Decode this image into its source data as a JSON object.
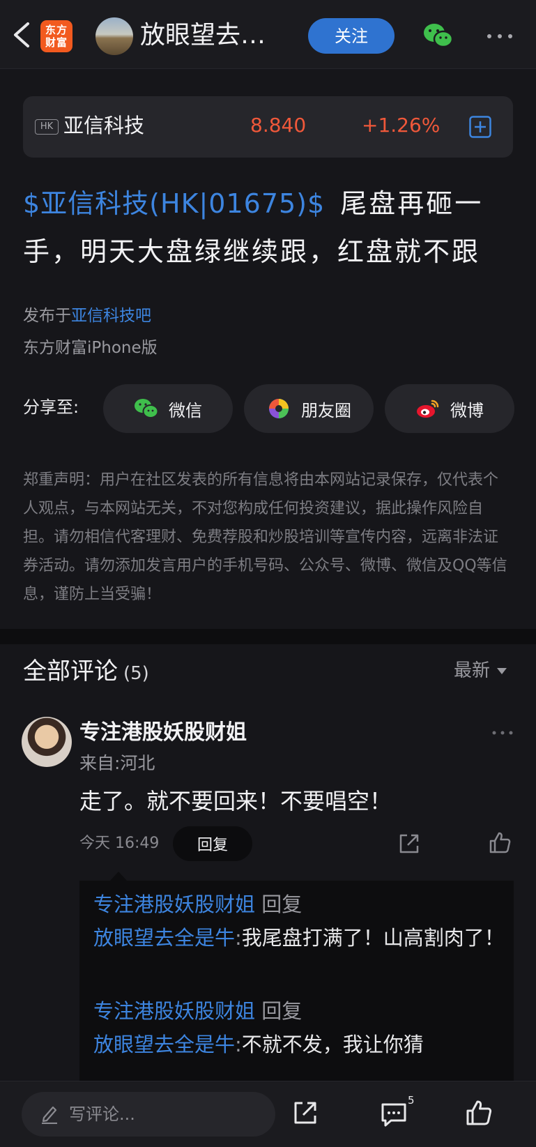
{
  "header": {
    "logo_text": "东方财富",
    "title": "放眼望去全是牛",
    "follow_label": "关注",
    "icons": [
      "back-icon",
      "wechat-icon",
      "more-icon"
    ]
  },
  "stock": {
    "market": "HK",
    "name": "亚信科技",
    "price": "8.840",
    "change": "+1.26%",
    "change_color": "#f0583a"
  },
  "post": {
    "tag": "$亚信科技(HK|01675)$",
    "text": "尾盘再砸一手，明天大盘绿继续跟，红盘就不跟"
  },
  "meta": {
    "published_prefix": "发布于",
    "forum": "亚信科技吧",
    "source": "东方财富iPhone版"
  },
  "share": {
    "label": "分享至:",
    "wechat": "微信",
    "moments": "朋友圈",
    "weibo": "微博"
  },
  "disclaimer": "郑重声明：用户在社区发表的所有信息将由本网站记录保存，仅代表个人观点，与本网站无关，不对您构成任何投资建议，据此操作风险自担。请勿相信代客理财、免费荐股和炒股培训等宣传内容，远离非法证券活动。请勿添加发言用户的手机号码、公众号、微博、微信及QQ等信息，谨防上当受骗！",
  "comments": {
    "title": "全部评论",
    "count": "(5)",
    "sort_label": "最新",
    "items": [
      {
        "user": "专注港股妖股财姐",
        "from": "来自:河北",
        "text": "走了。就不要回来！不要唱空！",
        "time": "今天 16:49",
        "reply_label": "回复",
        "replies": [
          {
            "from_user": "专注港股妖股财姐",
            "reply_word": "回复",
            "to_user": "放眼望去全是牛",
            "separator": ":",
            "text": "我尾盘打满了！山高割肉了！"
          },
          {
            "from_user": "专注港股妖股财姐",
            "reply_word": "回复",
            "to_user": "放眼望去全是牛",
            "separator": ":",
            "text": "不就不发，我让你猜"
          }
        ]
      }
    ]
  },
  "bottom_bar": {
    "input_placeholder": "写评论...",
    "comment_count": "5"
  },
  "colors": {
    "accent_blue": "#3d85e0",
    "follow_button": "#2f73d0",
    "price_red": "#f0583a",
    "background": "#16161a"
  }
}
